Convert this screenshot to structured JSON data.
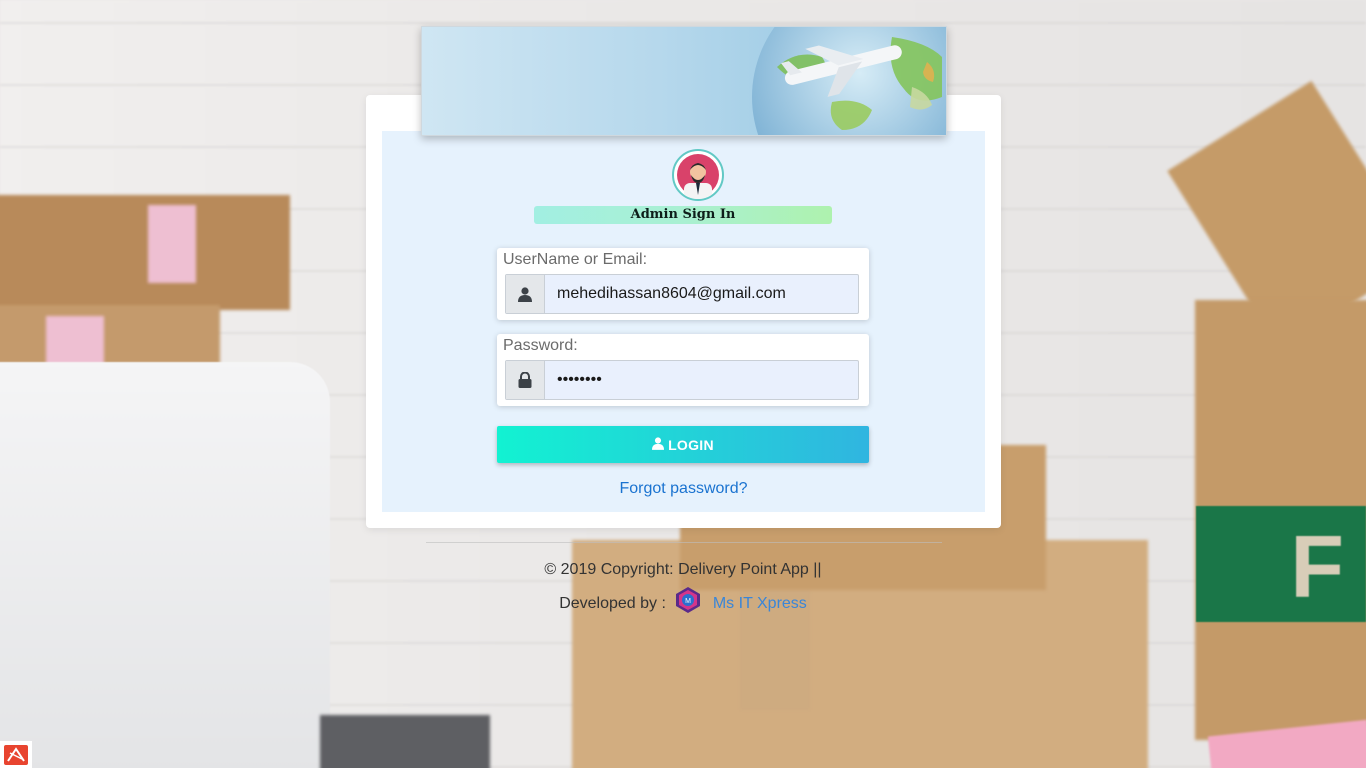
{
  "signin": {
    "title": "Admin Sign In",
    "username_label": "UserName or Email:",
    "username_value": "mehedihassan8604@gmail.com",
    "password_label": "Password:",
    "password_value": "password",
    "login_label": "LOGIN",
    "forgot_label": "Forgot password?"
  },
  "footer": {
    "copyright": "© 2019 Copyright: Delivery Point App ||",
    "developed_by": "Developed by :",
    "developer_name": "Ms IT Xpress"
  },
  "icons": {
    "username": "user-icon",
    "password": "lock-icon",
    "login": "user-icon",
    "avatar": "admin-avatar",
    "developer_logo": "ms-it-xpress-logo",
    "corner": "app-corner-icon"
  },
  "colors": {
    "link": "#1a73d0",
    "login_gradient_start": "#12f2d2",
    "login_gradient_end": "#30b5e0",
    "panel_background": "#e6f2fd"
  }
}
